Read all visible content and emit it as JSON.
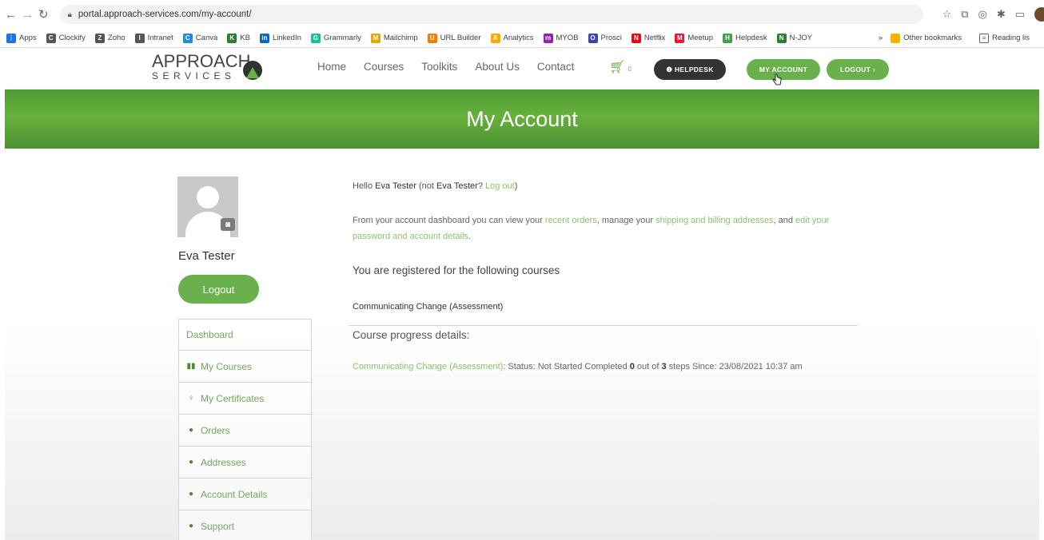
{
  "browser": {
    "url": "portal.approach-services.com/my-account/",
    "bookmarks": [
      {
        "label": "Apps",
        "color": "#1a73e8",
        "glyph": "⋮"
      },
      {
        "label": "Clockify",
        "color": "#555555",
        "glyph": "C"
      },
      {
        "label": "Zoho",
        "color": "#555555",
        "glyph": "Z"
      },
      {
        "label": "Intranet",
        "color": "#555555",
        "glyph": "I"
      },
      {
        "label": "Canva",
        "color": "#1e88e5",
        "glyph": "C"
      },
      {
        "label": "KB",
        "color": "#2e7d32",
        "glyph": "K"
      },
      {
        "label": "LinkedIn",
        "color": "#0a66c2",
        "glyph": "in"
      },
      {
        "label": "Grammarly",
        "color": "#15c39a",
        "glyph": "G"
      },
      {
        "label": "Mailchimp",
        "color": "#e0a800",
        "glyph": "M"
      },
      {
        "label": "URL Builder",
        "color": "#f57c00",
        "glyph": "U"
      },
      {
        "label": "Analytics",
        "color": "#f9ab00",
        "glyph": "A"
      },
      {
        "label": "MYOB",
        "color": "#8e24aa",
        "glyph": "m"
      },
      {
        "label": "Prosci",
        "color": "#3949ab",
        "glyph": "O"
      },
      {
        "label": "Netflix",
        "color": "#e50914",
        "glyph": "N"
      },
      {
        "label": "Meetup",
        "color": "#e51937",
        "glyph": "M"
      },
      {
        "label": "Helpdesk",
        "color": "#43a047",
        "glyph": "H"
      },
      {
        "label": "N-JOY",
        "color": "#2e7d32",
        "glyph": "N"
      }
    ],
    "other_bookmarks": "Other bookmarks",
    "reading_list": "Reading lis",
    "more": "»"
  },
  "site": {
    "logo_top": "APPROACH",
    "logo_bottom": "SERVICES",
    "nav": [
      "Home",
      "Courses",
      "Toolkits",
      "About Us",
      "Contact"
    ],
    "cart_count": "0",
    "helpdesk_label": "❶ HELPDESK",
    "my_account_label": "MY ACCOUNT",
    "logout_label": "LOGOUT ›"
  },
  "banner": {
    "title": "My Account"
  },
  "profile": {
    "name": "Eva Tester",
    "logout_button": "Logout"
  },
  "side_menu": [
    {
      "icon": "",
      "label": "Dashboard",
      "name": "sidebar-item-dashboard"
    },
    {
      "icon": "▮▮",
      "label": "My Courses",
      "name": "sidebar-item-my-courses"
    },
    {
      "icon": "♀",
      "label": "My Certificates",
      "name": "sidebar-item-my-certificates"
    },
    {
      "icon": "●",
      "label": "Orders",
      "name": "sidebar-item-orders"
    },
    {
      "icon": "●",
      "label": "Addresses",
      "name": "sidebar-item-addresses"
    },
    {
      "icon": "●",
      "label": "Account Details",
      "name": "sidebar-item-account-details"
    },
    {
      "icon": "●",
      "label": "Support",
      "name": "sidebar-item-support"
    }
  ],
  "dashboard": {
    "hello_prefix": "Hello",
    "hello_name": "Eva Tester",
    "hello_not": "(not",
    "hello_name2": "Eva Tester",
    "hello_q": "?",
    "logout_link": "Log out",
    "hello_close": ")",
    "para_1": "From your account dashboard you can view your",
    "recent_orders": "recent orders",
    "para_2": ", manage your",
    "addresses_link": "shipping and billing addresses",
    "para_3": ", and",
    "account_link": "edit your password and account details",
    "para_4": ".",
    "registered_heading": "You are registered for the following courses",
    "course_name": "Communicating Change (Assessment)",
    "progress_heading": "Course progress details:",
    "progress_course_link": "Communicating Change (Assessment)",
    "progress_status": ": Status: Not Started Completed",
    "progress_done": "0",
    "progress_mid": "out of",
    "progress_total": "3",
    "progress_since": "steps Since: 23/08/2021 10:37 am"
  },
  "colors": {
    "brand_green": "#6ab04c",
    "dark": "#333333",
    "link_green": "#8fbf6e"
  }
}
